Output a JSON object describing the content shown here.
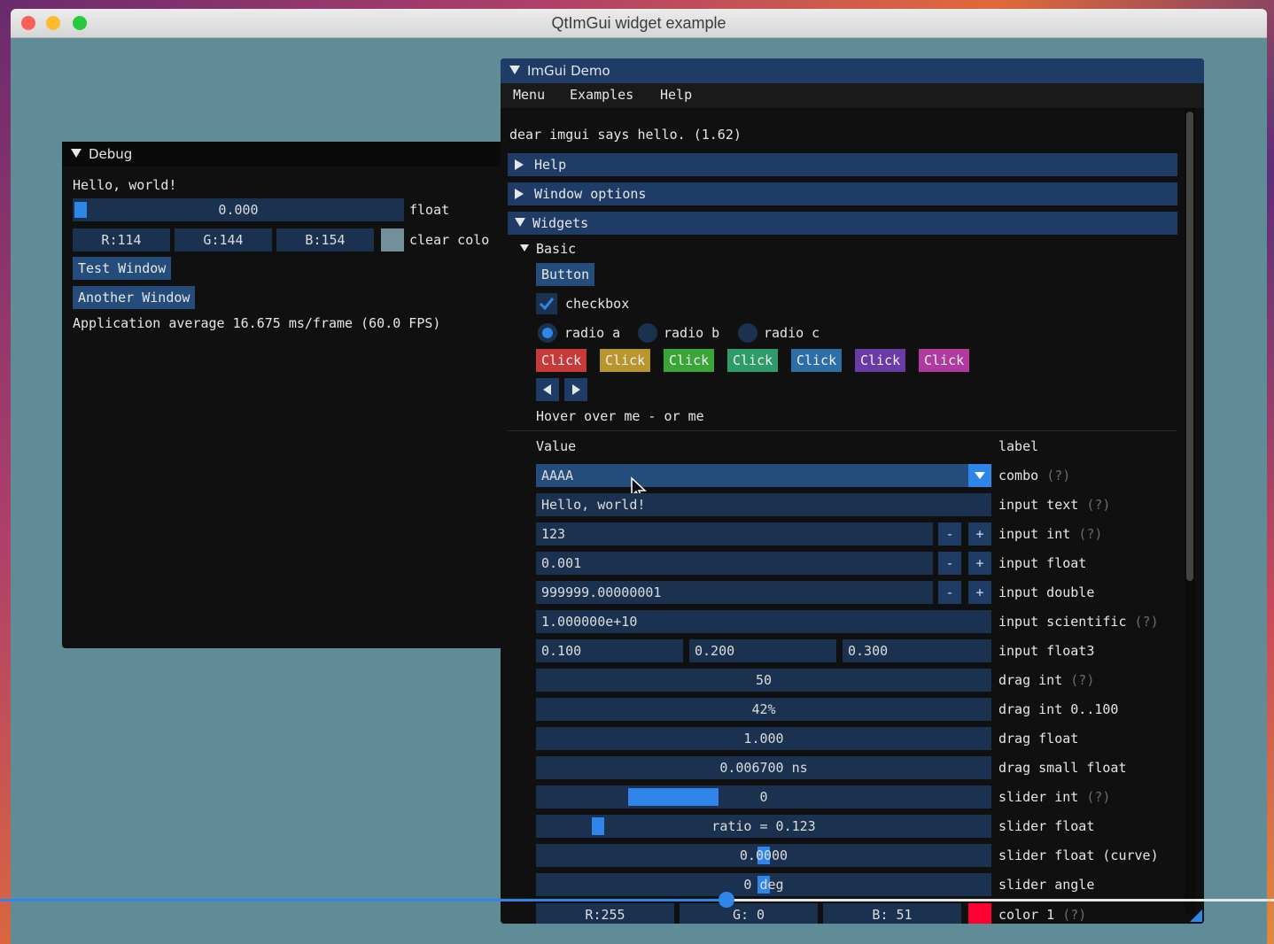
{
  "app": {
    "title": "QtImGui widget example"
  },
  "debug": {
    "title": "Debug",
    "hello": "Hello, world!",
    "float_value": "0.000",
    "float_label": "float",
    "float_fraction": 0.0,
    "color_r": "R:114",
    "color_g": "G:144",
    "color_b": "B:154",
    "swatch_color": "#72909a",
    "clear_label": "clear colo",
    "test_window": "Test Window",
    "another_window": "Another Window",
    "fps": "Application average 16.675 ms/frame (60.0 FPS)"
  },
  "demo": {
    "title": "ImGui Demo",
    "menu": [
      "Menu",
      "Examples",
      "Help"
    ],
    "hello": "dear imgui says hello. (1.62)",
    "sections": {
      "help": "Help",
      "window_options": "Window options",
      "widgets": "Widgets",
      "basic": "Basic"
    },
    "button": "Button",
    "checkbox": "checkbox",
    "radios": [
      "radio a",
      "radio b",
      "radio c"
    ],
    "click_buttons": [
      {
        "label": "Click",
        "color": "#c83a3a"
      },
      {
        "label": "Click",
        "color": "#b8962e"
      },
      {
        "label": "Click",
        "color": "#3aa63a"
      },
      {
        "label": "Click",
        "color": "#2e9c6a"
      },
      {
        "label": "Click",
        "color": "#2e6ea6"
      },
      {
        "label": "Click",
        "color": "#6a3aa6"
      },
      {
        "label": "Click",
        "color": "#b03aa0"
      }
    ],
    "hover": "Hover over me - or me",
    "columns": {
      "value": "Value",
      "label": "label"
    },
    "help_mark": "(?)",
    "combo_value": "AAAA",
    "combo_label": "combo",
    "input_text_value": "Hello, world!",
    "input_text_label": "input text",
    "input_int_value": "123",
    "input_int_label": "input int",
    "input_float_value": "0.001",
    "input_float_label": "input float",
    "input_double_value": "999999.00000001",
    "input_double_label": "input double",
    "input_sci_value": "1.000000e+10",
    "input_sci_label": "input scientific",
    "float3": [
      "0.100",
      "0.200",
      "0.300"
    ],
    "float3_label": "input float3",
    "drag_int_value": "50",
    "drag_int_label": "drag int",
    "drag_int100_value": "42%",
    "drag_int100_label": "drag int 0..100",
    "drag_float_value": "1.000",
    "drag_float_label": "drag float",
    "drag_small_value": "0.006700 ns",
    "drag_small_label": "drag small float",
    "slider_int_value": "0",
    "slider_int_label": "slider int",
    "slider_float_value": "ratio = 0.123",
    "slider_float_label": "slider float",
    "slider_float_fraction": 0.123,
    "slider_curve_value": "0.0000",
    "slider_curve_label": "slider float (curve)",
    "slider_angle_value": "0 deg",
    "slider_angle_label": "slider angle",
    "color1": [
      "R:255",
      "G: 0",
      "B: 51"
    ],
    "color1_label": "color 1",
    "color1_swatch": "#ff0033",
    "minus": "-",
    "plus": "+"
  },
  "video": {
    "progress_fraction": 0.57
  }
}
